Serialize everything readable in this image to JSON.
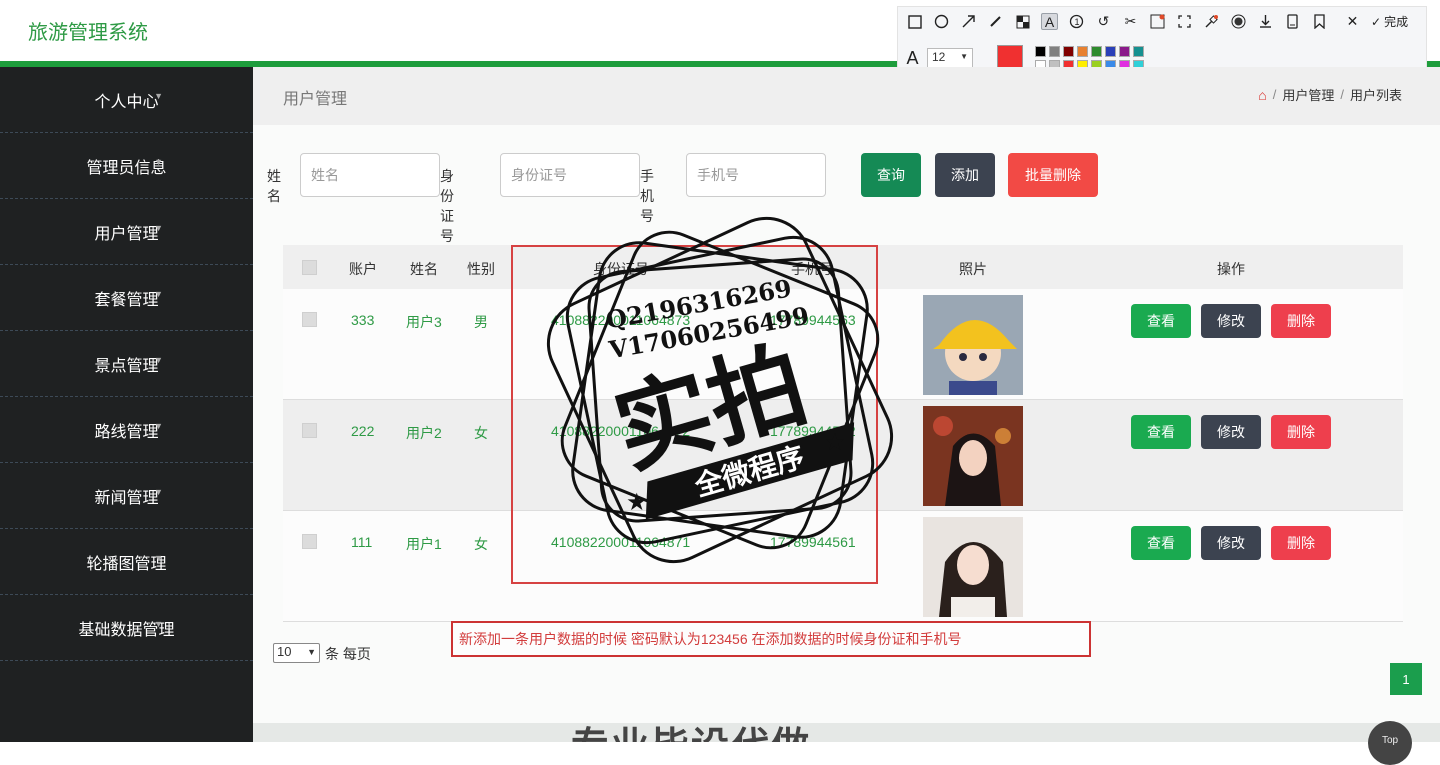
{
  "app": {
    "title": "旅游管理系统"
  },
  "colors": {
    "primary": "#1e9d3c",
    "sidebar_bg": "#1f2122",
    "view": "#1aaa50",
    "edit": "#3c4350",
    "delete": "#ee3f4d",
    "batch_delete": "#f24a45"
  },
  "toolbar": {
    "icons": [
      "rectangle-icon",
      "circle-icon",
      "arrow-icon",
      "pen-icon",
      "mosaic-icon",
      "text-icon",
      "number-icon",
      "undo-icon",
      "scissors-icon",
      "ocr-icon",
      "crop-icon",
      "pin-icon",
      "record-icon",
      "download-icon",
      "save-icon",
      "bookmark-icon",
      "close-icon"
    ],
    "done_label": "完成",
    "font_size": "12"
  },
  "sidebar": {
    "items": [
      {
        "label": "个人中心"
      },
      {
        "label": "管理员信息"
      },
      {
        "label": "用户管理"
      },
      {
        "label": "套餐管理"
      },
      {
        "label": "景点管理"
      },
      {
        "label": "路线管理"
      },
      {
        "label": "新闻管理"
      },
      {
        "label": "轮播图管理"
      },
      {
        "label": "基础数据管理"
      }
    ]
  },
  "page": {
    "title": "用户管理",
    "breadcrumb": [
      "用户管理",
      "用户列表"
    ]
  },
  "search": {
    "name_label": "姓名",
    "name_placeholder": "姓名",
    "id_label": "身份证号",
    "id_placeholder": "身份证号",
    "phone_label": "手机号",
    "phone_placeholder": "手机号",
    "query_label": "查询",
    "add_label": "添加",
    "batch_delete_label": "批量删除"
  },
  "table": {
    "headers": [
      "账户",
      "姓名",
      "性别",
      "身份证号",
      "手机号",
      "照片",
      "操作"
    ],
    "rows": [
      {
        "account": "333",
        "name": "用户3",
        "gender": "男",
        "id_card": "410882200011064873",
        "phone": "17789944563"
      },
      {
        "account": "222",
        "name": "用户2",
        "gender": "女",
        "id_card": "410882200011064872",
        "phone": "17789944562"
      },
      {
        "account": "111",
        "name": "用户1",
        "gender": "女",
        "id_card": "410882200011064871",
        "phone": "17789944561"
      }
    ],
    "view_label": "查看",
    "edit_label": "修改",
    "delete_label": "删除"
  },
  "pagination": {
    "page_size": "10",
    "per_page_label": "条 每页",
    "current_page": "1"
  },
  "footer": {
    "text": "专业毕设代做",
    "top_label": "Top"
  },
  "annotation": {
    "note": "新添加一条用户数据的时候 密码默认为123456 在添加数据的时候身份证和手机号"
  },
  "watermark": {
    "contact_q": "Q2196316269",
    "contact_v": "V17060256499",
    "big_text": "实拍",
    "ribbon_text": "全微程序"
  }
}
